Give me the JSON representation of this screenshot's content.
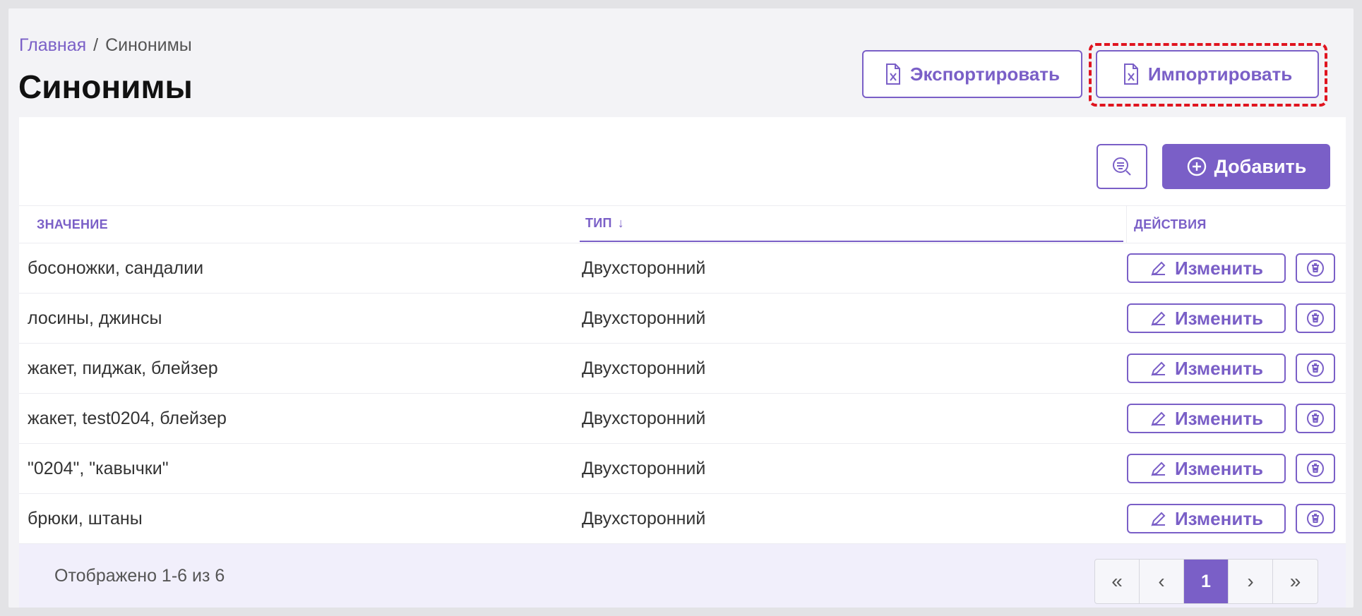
{
  "breadcrumb": {
    "home": "Главная",
    "separator": "/",
    "current": "Синонимы"
  },
  "title": "Синонимы",
  "toolbar": {
    "export_label": "Экспортировать",
    "import_label": "Импортировать",
    "add_label": "Добавить"
  },
  "table": {
    "headers": {
      "value": "Значение",
      "type": "Тип",
      "actions": "Действия"
    },
    "sort_indicator": "↓",
    "edit_label": "Изменить",
    "rows": [
      {
        "value": "босоножки, сандалии",
        "type": "Двухсторонний"
      },
      {
        "value": "лосины, джинсы",
        "type": "Двухсторонний"
      },
      {
        "value": "жакет, пиджак, блейзер",
        "type": "Двухсторонний"
      },
      {
        "value": "жакет, test0204, блейзер",
        "type": "Двухсторонний"
      },
      {
        "value": "\"0204\", \"кавычки\"",
        "type": "Двухсторонний"
      },
      {
        "value": "брюки, штаны",
        "type": "Двухсторонний"
      }
    ]
  },
  "footer": {
    "shown_text": "Отображено 1-6 из 6",
    "pagination": {
      "first": "«",
      "prev": "‹",
      "current_page": "1",
      "next": "›",
      "last": "»"
    }
  },
  "colors": {
    "accent": "#7a5fc7",
    "highlight": "#e0141f",
    "background": "#f3f3f6"
  },
  "icons": [
    "excel-file-icon",
    "filter-search-icon",
    "plus-circle-icon",
    "pencil-icon",
    "trash-icon"
  ]
}
